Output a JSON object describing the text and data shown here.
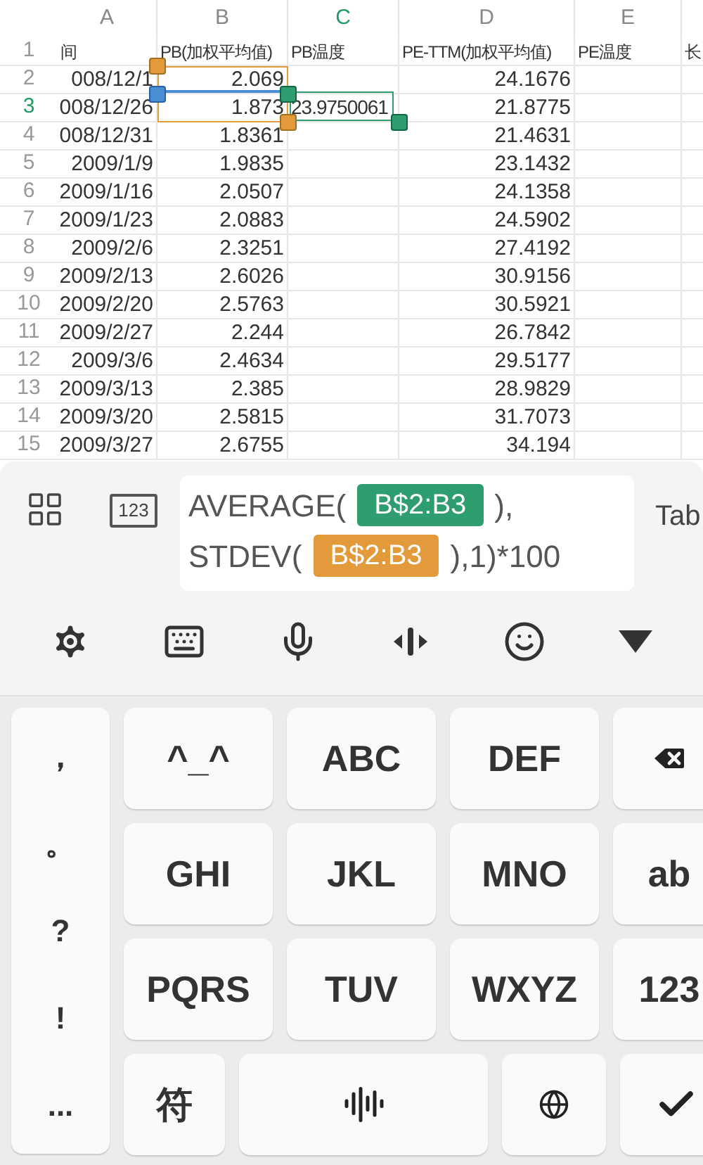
{
  "sheet": {
    "columns": [
      {
        "label": "A",
        "selected": false
      },
      {
        "label": "B",
        "selected": false
      },
      {
        "label": "C",
        "selected": true
      },
      {
        "label": "D",
        "selected": false
      },
      {
        "label": "E",
        "selected": false
      }
    ],
    "rows": [
      {
        "label": "1",
        "selected": false,
        "cells": [
          "间",
          "PB(加权平均值)",
          "PB温度",
          "PE-TTM(加权平均值)",
          "PE温度",
          "长"
        ]
      },
      {
        "label": "2",
        "selected": false,
        "cells": [
          "008/12/1",
          "2.069",
          "",
          "24.1676",
          "",
          ""
        ]
      },
      {
        "label": "3",
        "selected": true,
        "cells": [
          "008/12/26",
          "1.873",
          "23.9750061",
          "21.8775",
          "",
          ""
        ]
      },
      {
        "label": "4",
        "selected": false,
        "cells": [
          "008/12/31",
          "1.8361",
          "",
          "21.4631",
          "",
          ""
        ]
      },
      {
        "label": "5",
        "selected": false,
        "cells": [
          "2009/1/9",
          "1.9835",
          "",
          "23.1432",
          "",
          ""
        ]
      },
      {
        "label": "6",
        "selected": false,
        "cells": [
          "2009/1/16",
          "2.0507",
          "",
          "24.1358",
          "",
          ""
        ]
      },
      {
        "label": "7",
        "selected": false,
        "cells": [
          "2009/1/23",
          "2.0883",
          "",
          "24.5902",
          "",
          ""
        ]
      },
      {
        "label": "8",
        "selected": false,
        "cells": [
          "2009/2/6",
          "2.3251",
          "",
          "27.4192",
          "",
          ""
        ]
      },
      {
        "label": "9",
        "selected": false,
        "cells": [
          "2009/2/13",
          "2.6026",
          "",
          "30.9156",
          "",
          ""
        ]
      },
      {
        "label": "10",
        "selected": false,
        "cells": [
          "2009/2/20",
          "2.5763",
          "",
          "30.5921",
          "",
          ""
        ]
      },
      {
        "label": "11",
        "selected": false,
        "cells": [
          "2009/2/27",
          "2.244",
          "",
          "26.7842",
          "",
          ""
        ]
      },
      {
        "label": "12",
        "selected": false,
        "cells": [
          "2009/3/6",
          "2.4634",
          "",
          "29.5177",
          "",
          ""
        ]
      },
      {
        "label": "13",
        "selected": false,
        "cells": [
          "2009/3/13",
          "2.385",
          "",
          "28.9829",
          "",
          ""
        ]
      },
      {
        "label": "14",
        "selected": false,
        "cells": [
          "2009/3/20",
          "2.5815",
          "",
          "31.7073",
          "",
          ""
        ]
      },
      {
        "label": "15",
        "selected": false,
        "cells": [
          "2009/3/27",
          "2.6755",
          "",
          "34.194",
          "",
          ""
        ]
      }
    ]
  },
  "formula": {
    "lines": [
      [
        {
          "kind": "text",
          "text": "AVERAGE("
        },
        {
          "kind": "ref",
          "text": "B$2:B3",
          "color": "#2e9e6e"
        },
        {
          "kind": "text",
          "text": "),"
        }
      ],
      [
        {
          "kind": "text",
          "text": "STDEV("
        },
        {
          "kind": "ref",
          "text": "B$2:B3",
          "color": "#e39a3b"
        },
        {
          "kind": "text",
          "text": "),1)*100"
        }
      ]
    ],
    "keypad_label": "123",
    "tab_label": "Tab"
  },
  "keyboard": {
    "side_keys": [
      "，",
      "。",
      "?",
      "!",
      "..."
    ],
    "rows": [
      [
        {
          "kind": "text",
          "text": "^_^"
        },
        {
          "kind": "text",
          "text": "ABC"
        },
        {
          "kind": "text",
          "text": "DEF"
        },
        {
          "kind": "backspace"
        }
      ],
      [
        {
          "kind": "text",
          "text": "GHI"
        },
        {
          "kind": "text",
          "text": "JKL"
        },
        {
          "kind": "text",
          "text": "MNO"
        },
        {
          "kind": "text",
          "text": "ab"
        }
      ],
      [
        {
          "kind": "text",
          "text": "PQRS"
        },
        {
          "kind": "text",
          "text": "TUV"
        },
        {
          "kind": "text",
          "text": "WXYZ"
        },
        {
          "kind": "text",
          "text": "123"
        }
      ]
    ],
    "bottom": [
      {
        "kind": "text",
        "text": "符"
      },
      {
        "kind": "voice"
      },
      {
        "kind": "globe"
      },
      {
        "kind": "enter"
      }
    ]
  }
}
